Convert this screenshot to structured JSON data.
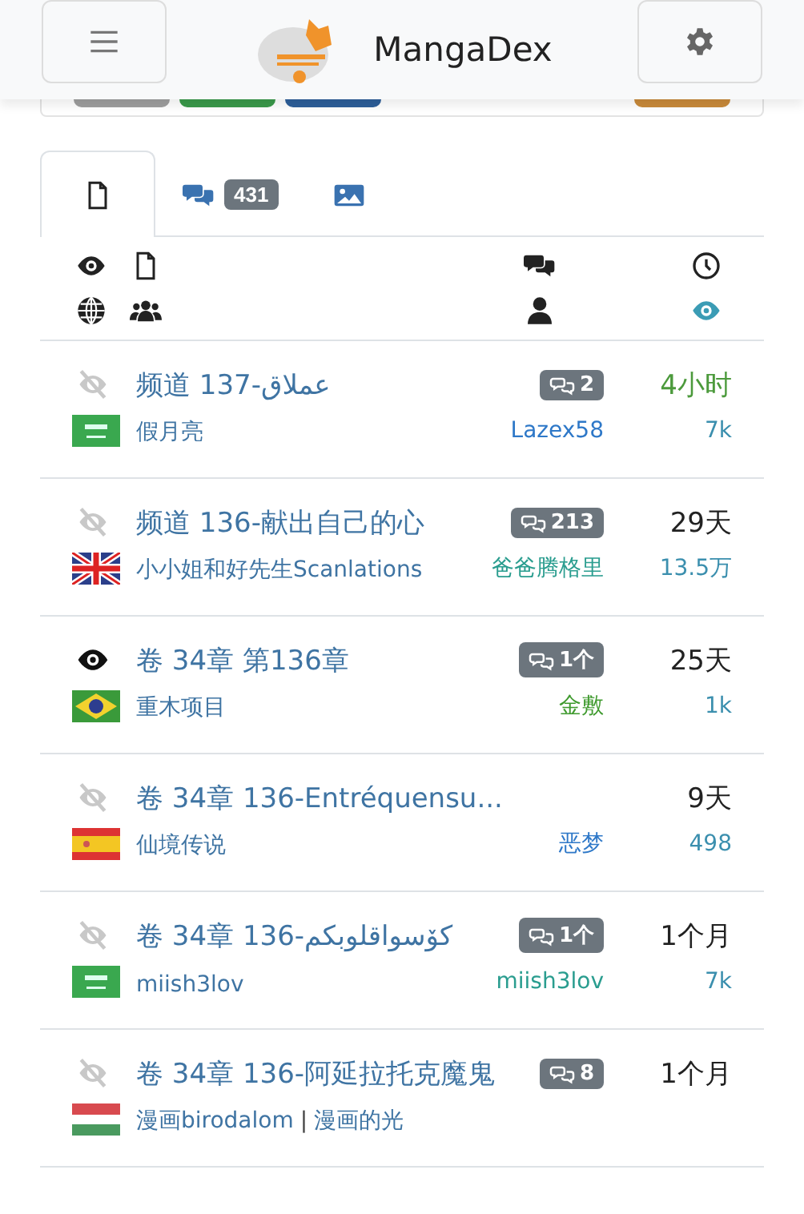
{
  "header": {
    "title": "MangaDex"
  },
  "top_buttons": [
    {
      "color": "#9e9e9e"
    },
    {
      "color": "#3a9a4a"
    },
    {
      "color": "#2d5f9a"
    },
    {
      "color": "#c98a3a"
    }
  ],
  "tabs": [
    {
      "kind": "chapters",
      "selected": true
    },
    {
      "kind": "comments",
      "badge": "431",
      "selected": false
    },
    {
      "kind": "images",
      "selected": false
    }
  ],
  "rows": [
    {
      "read": false,
      "title": "频道 137-عملاق",
      "flag": {
        "kind": "sa"
      },
      "groups": [
        "假月亮"
      ],
      "comments": "2",
      "time": {
        "text": "4小时",
        "color": "#4c9a3c"
      },
      "uploader": {
        "name": "Lazex58",
        "color": "#2e78c8"
      },
      "views": "7k"
    },
    {
      "read": false,
      "title": "频道 136-献出自己的心",
      "flag": {
        "kind": "gb"
      },
      "groups": [
        "小小姐和好先生Scanlations"
      ],
      "comments": "213",
      "time": {
        "text": "29天",
        "color": "#222222"
      },
      "uploader": {
        "name": "爸爸腾格里",
        "color": "#2a9d8f"
      },
      "views": "13.5万"
    },
    {
      "read": true,
      "title": "卷 34章 第136章",
      "flag": {
        "kind": "br"
      },
      "groups": [
        "重木项目"
      ],
      "comments": "1个",
      "time": {
        "text": "25天",
        "color": "#222222"
      },
      "uploader": {
        "name": "金敷",
        "color": "#3f9a2e"
      },
      "views": "1k"
    },
    {
      "read": false,
      "title": "卷 34章 136-Entréquensu...",
      "flag": {
        "kind": "es"
      },
      "groups": [
        "仙境传说"
      ],
      "time": {
        "text": "9天",
        "color": "#222222"
      },
      "uploader": {
        "name": "恶梦",
        "color": "#2e78c8"
      },
      "views": "498"
    },
    {
      "read": false,
      "title": "卷 34章 136-كۆسواقلوبكم",
      "flag": {
        "kind": "sa"
      },
      "groups": [
        "miish3lov"
      ],
      "comments": "1个",
      "time": {
        "text": "1个月",
        "color": "#222222"
      },
      "uploader": {
        "name": "miish3lov",
        "color": "#2a9d8f"
      },
      "views": "7k"
    },
    {
      "read": false,
      "title": "卷 34章 136-阿延拉托克魔鬼",
      "flag": {
        "kind": "hu"
      },
      "groups": [
        "漫画birodalom",
        "漫画的光"
      ],
      "group_separator": "|",
      "comments": "8",
      "time": {
        "text": "1个月",
        "color": "#222222"
      }
    }
  ]
}
